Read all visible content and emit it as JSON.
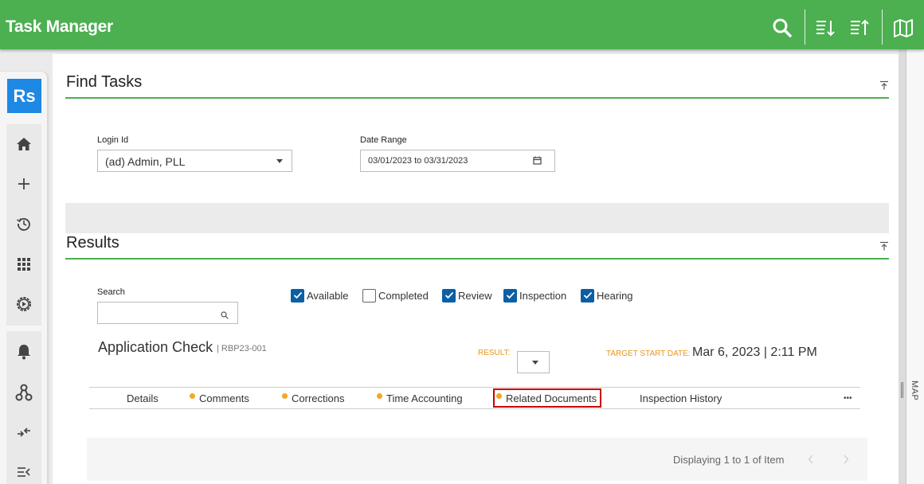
{
  "header": {
    "title": "Task Manager",
    "icons": [
      "search-icon",
      "sort-descending-icon",
      "sort-ascending-icon",
      "map-icon"
    ]
  },
  "sidebar": {
    "logo": "Rs",
    "items": [
      "home-icon",
      "add-icon",
      "history-icon",
      "apps-grid-icon",
      "settings-play-icon",
      "bell-icon",
      "workflow-icon",
      "transfer-icon",
      "menu-collapse-icon"
    ]
  },
  "find_tasks": {
    "title": "Find Tasks",
    "login_label": "Login Id",
    "login_value": "(ad) Admin, PLL",
    "date_label": "Date Range",
    "date_value": "03/01/2023 to 03/31/2023"
  },
  "results": {
    "title": "Results",
    "search_label": "Search",
    "search_value": "",
    "filters": [
      {
        "label": "Available",
        "checked": true
      },
      {
        "label": "Completed",
        "checked": false
      },
      {
        "label": "Review",
        "checked": true
      },
      {
        "label": "Inspection",
        "checked": true
      },
      {
        "label": "Hearing",
        "checked": true
      }
    ],
    "task_title": "Application Check",
    "task_id": "| RBP23-001",
    "result_label": "RESULT:",
    "target_label": "TARGET START DATE:",
    "target_value": "Mar 6, 2023 | 2:11 PM",
    "tabs": [
      {
        "label": "Details",
        "dot": false
      },
      {
        "label": "Comments",
        "dot": true
      },
      {
        "label": "Corrections",
        "dot": true
      },
      {
        "label": "Time Accounting",
        "dot": true
      },
      {
        "label": "Related Documents",
        "dot": true,
        "active": true
      },
      {
        "label": "Inspection History",
        "dot": false
      }
    ],
    "more_label": "•••",
    "pager_text": "Displaying 1 to 1 of Item"
  },
  "map_tab": {
    "label": "MAP"
  },
  "colors": {
    "brand_green": "#4caf50",
    "accent_blue": "#1e88e5",
    "checkbox_blue": "#0b5fa5",
    "label_orange": "#e8961a",
    "dot_orange": "#f5a623",
    "active_tab_border": "#cc0000"
  }
}
